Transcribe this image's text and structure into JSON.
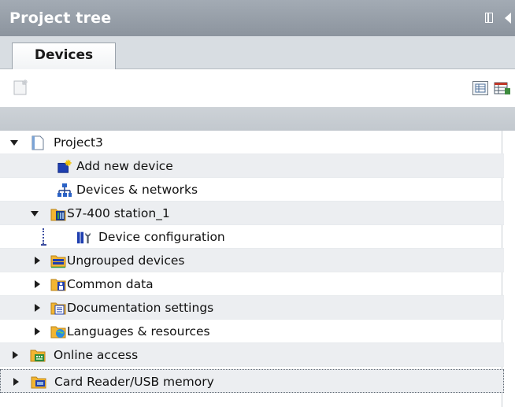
{
  "panel": {
    "title": "Project tree",
    "pin_icon": "pin-icon",
    "collapse_icon": "collapse-left-icon"
  },
  "tabs": [
    {
      "label": "Devices",
      "active": true
    }
  ],
  "toolbar": {
    "new_icon": "new-document-icon",
    "view_icon": "overview-icon",
    "view2_icon": "detail-view-icon"
  },
  "tree": {
    "items": [
      {
        "label": "Project3",
        "icon": "project-icon",
        "state": "expanded"
      },
      {
        "label": "Add new device",
        "icon": "add-device-icon",
        "state": "leaf"
      },
      {
        "label": "Devices & networks",
        "icon": "network-icon",
        "state": "leaf"
      },
      {
        "label": "S7-400 station_1",
        "icon": "station-folder-icon",
        "state": "expanded"
      },
      {
        "label": "Device configuration",
        "icon": "device-config-icon",
        "state": "leaf"
      },
      {
        "label": "Ungrouped devices",
        "icon": "ungrouped-devices-icon",
        "state": "collapsed"
      },
      {
        "label": "Common data",
        "icon": "common-data-icon",
        "state": "collapsed"
      },
      {
        "label": "Documentation settings",
        "icon": "documentation-icon",
        "state": "collapsed"
      },
      {
        "label": "Languages & resources",
        "icon": "languages-icon",
        "state": "collapsed"
      },
      {
        "label": "Online access",
        "icon": "online-access-icon",
        "state": "collapsed"
      },
      {
        "label": "Card Reader/USB memory",
        "icon": "card-reader-icon",
        "state": "collapsed",
        "selected": true
      }
    ]
  },
  "colors": {
    "titlebar": "#98a0a9",
    "row_alt": "#eceef1",
    "folder": "#f2b531"
  }
}
